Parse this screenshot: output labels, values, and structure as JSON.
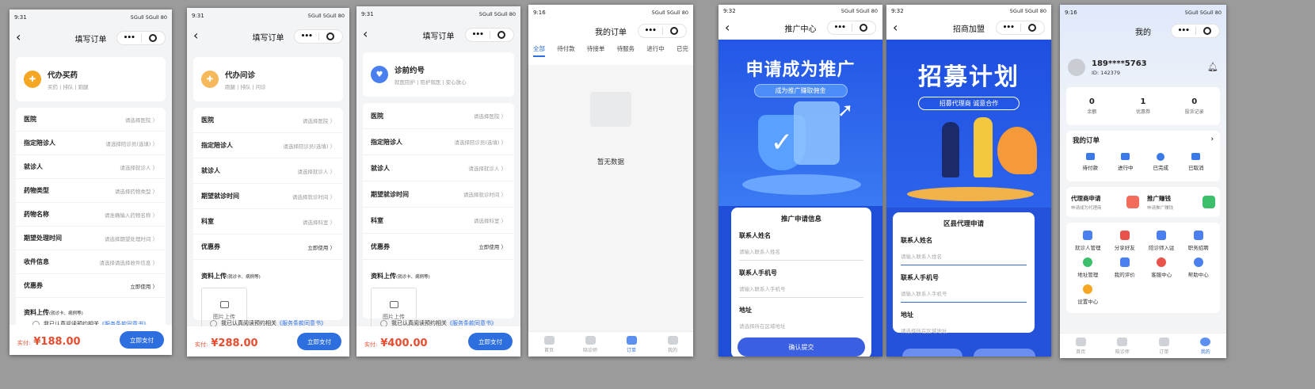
{
  "order_pages": [
    {
      "status_time": "9:31",
      "status_right": "5Gull 5Gull 80",
      "nav_title": "填写订单",
      "service_title": "代办买药",
      "service_sub": "买药 | 排队 | 跑腿",
      "icon": "pill-bag-icon",
      "icon_color": "#f5a623",
      "rows": [
        {
          "label": "医院",
          "hint": "请选择医院 〉"
        },
        {
          "label": "指定陪诊人",
          "hint": "请选择陪诊员(选填) 〉"
        },
        {
          "label": "就诊人",
          "hint": "请选择就诊人 〉"
        },
        {
          "label": "药物类型",
          "hint": "请选择药物类型 〉"
        },
        {
          "label": "药物名称",
          "hint": "请准确输入药物名称 〉"
        },
        {
          "label": "期望处理时间",
          "hint": "请选择期望处理时间 〉"
        },
        {
          "label": "收件信息",
          "hint": "请选择请选择收件信息 〉"
        },
        {
          "label": "优惠券",
          "hint": "立即使用 〉",
          "dark": true
        }
      ],
      "upload_label": "资料上传",
      "upload_sub": "(就诊卡、病例等)",
      "agree_prefix": "我已认真阅读预约相关",
      "agree_link": "《服务条款同意书》",
      "pay_label": "实付:",
      "price": "¥188.00",
      "pay_button": "立即支付"
    },
    {
      "status_time": "9:31",
      "status_right": "5Gull 5Gull 80",
      "nav_title": "填写订单",
      "service_title": "代办问诊",
      "service_sub": "跑腿 | 排队 | 问诊",
      "icon": "clinic-icon",
      "icon_color": "#f5b85a",
      "rows": [
        {
          "label": "医院",
          "hint": "请选择医院 〉"
        },
        {
          "label": "指定陪诊人",
          "hint": "请选择陪诊员(选填) 〉"
        },
        {
          "label": "就诊人",
          "hint": "请选择就诊人 〉"
        },
        {
          "label": "期望就诊时间",
          "hint": "请选择就诊时间 〉"
        },
        {
          "label": "科室",
          "hint": "请选择科室 〉"
        },
        {
          "label": "优惠券",
          "hint": "立即使用 〉",
          "dark": true
        }
      ],
      "upload_label": "资料上传",
      "upload_sub": "(就诊卡、病例等)",
      "upload_box": "图片上传",
      "agree_prefix": "我已认真阅读预约相关",
      "agree_link": "《服务条款同意书》",
      "pay_label": "实付:",
      "price": "¥288.00",
      "pay_button": "立即支付"
    },
    {
      "status_time": "9:31",
      "status_right": "5Gull 5Gull 80",
      "nav_title": "填写订单",
      "service_title": "诊前约号",
      "service_sub": "就医陪护 | 陪护就医 | 安心放心",
      "icon": "heart-icon",
      "icon_color": "#4a7ff0",
      "rows": [
        {
          "label": "医院",
          "hint": "请选择医院 〉"
        },
        {
          "label": "指定陪诊人",
          "hint": "请选择陪诊员(选填) 〉"
        },
        {
          "label": "就诊人",
          "hint": "请选择就诊人 〉"
        },
        {
          "label": "期望就诊时间",
          "hint": "请选择就诊时间 〉"
        },
        {
          "label": "科室",
          "hint": "请选择科室 〉"
        },
        {
          "label": "优惠券",
          "hint": "立即使用 〉",
          "dark": true
        }
      ],
      "upload_label": "资料上传",
      "upload_sub": "(就诊卡、病例等)",
      "upload_box": "图片上传",
      "agree_prefix": "我已认真阅读预约相关",
      "agree_link": "《服务条款同意书》",
      "pay_label": "实付:",
      "price": "¥400.00",
      "pay_button": "立即支付"
    }
  ],
  "orders_page": {
    "status_time": "9:16",
    "status_right": "5Gull 5Gull 80",
    "nav_title": "我的订单",
    "tabs": [
      "全部",
      "待付款",
      "待接单",
      "待服务",
      "进行中",
      "已完"
    ],
    "empty_text": "暂无数据",
    "tabbar": [
      "首页",
      "陪诊师",
      "订单",
      "我的"
    ]
  },
  "promo_page": {
    "status_time": "9:32",
    "status_right": "5Gull 5Gull 80",
    "nav_title": "推广中心",
    "banner_title": "申请成为推广",
    "banner_sub": "成为推广赚取佣金",
    "form_title": "推广申请信息",
    "fields": [
      {
        "label": "联系人姓名",
        "placeholder": "请输入联系人姓名"
      },
      {
        "label": "联系人手机号",
        "placeholder": "请输入联系人手机号"
      },
      {
        "label": "地址",
        "placeholder": "请选择所在区域地址"
      }
    ],
    "submit": "确认提交"
  },
  "recruit_page": {
    "status_time": "9:32",
    "status_right": "5Gull 5Gull 80",
    "nav_title": "招商加盟",
    "banner_title": "招募计划",
    "banner_sub": "招募代理商    诚意合作",
    "form_title": "区县代理申请",
    "fields": [
      {
        "label": "联系人姓名",
        "placeholder": "请输入联系人姓名"
      },
      {
        "label": "联系人手机号",
        "placeholder": "请输入联系人手机号"
      },
      {
        "label": "地址",
        "placeholder": "请选择所在区域地址"
      }
    ]
  },
  "profile_page": {
    "status_time": "9:16",
    "status_right": "5Gull 5Gull 80",
    "nav_title": "我的",
    "phone": "189****5763",
    "user_id": "ID:  142379",
    "stats": [
      {
        "value": "0",
        "label": "余额"
      },
      {
        "value": "1",
        "label": "优惠券"
      },
      {
        "value": "0",
        "label": "投诉记录"
      }
    ],
    "orders_title": "我的订单",
    "order_items": [
      "待付款",
      "进行中",
      "已完成",
      "已取消"
    ],
    "promo_left_title": "代理商申请",
    "promo_left_sub": "申请成为代理商",
    "promo_right_title": "推广赚钱",
    "promo_right_sub": "申请推广赚钱",
    "menu": [
      "就诊人管理",
      "分享好友",
      "陪诊师入驻",
      "职务招聘",
      "地址管理",
      "我的评价",
      "客服中心",
      "帮助中心",
      "设置中心"
    ],
    "tabbar": [
      "首页",
      "陪诊师",
      "订单",
      "我的"
    ]
  },
  "colors": {
    "accent": "#2e6fe0",
    "price": "#e84c2e",
    "promo_bg": "#1f4fd8",
    "recruit_bg": "#2452d9"
  }
}
